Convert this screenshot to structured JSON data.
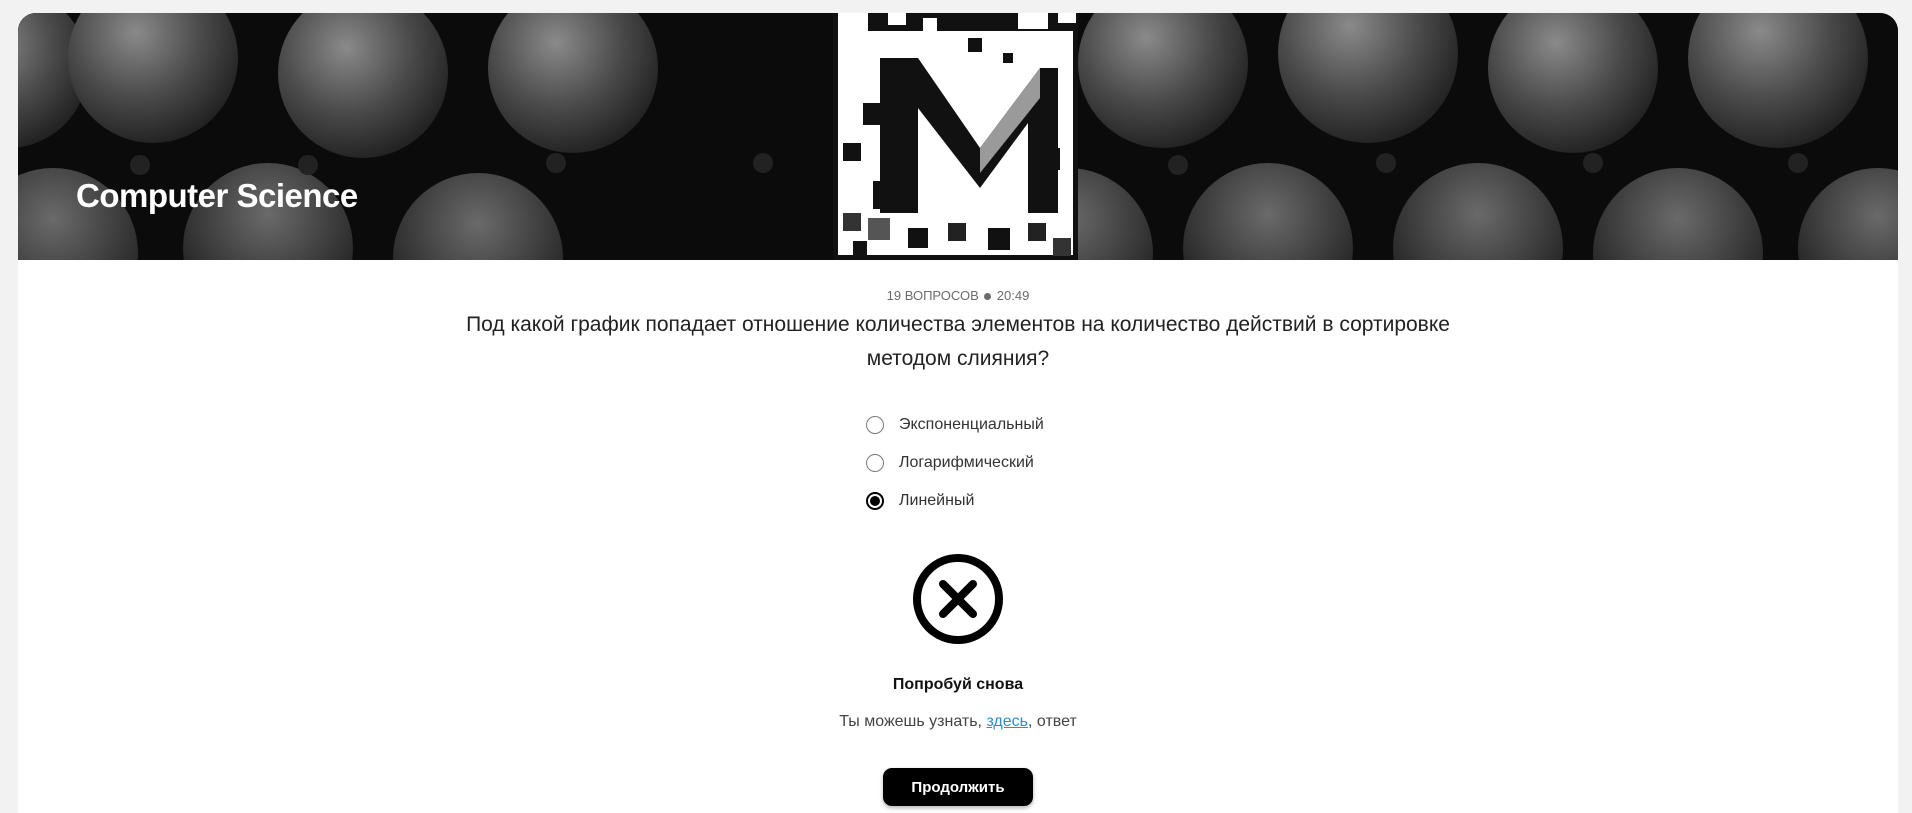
{
  "banner": {
    "title": "Computer Science"
  },
  "meta": {
    "questions": "19 ВОПРОСОВ",
    "time": "20:49"
  },
  "question": {
    "text": "Под какой график попадает отношение количества элементов на количество действий в сортировке методом слияния?"
  },
  "options": [
    {
      "label": "Экспоненциальный",
      "selected": false
    },
    {
      "label": "Логарифмический",
      "selected": false
    },
    {
      "label": "Линейный",
      "selected": true
    }
  ],
  "result": {
    "icon": "close-circle-icon",
    "title": "Попробуй снова",
    "hint_before": "Ты можешь узнать, ",
    "hint_link": "здесь",
    "hint_after": ", ответ"
  },
  "actions": {
    "continue_label": "Продолжить"
  },
  "colors": {
    "accent": "#000000",
    "link": "#2a8fd6"
  }
}
